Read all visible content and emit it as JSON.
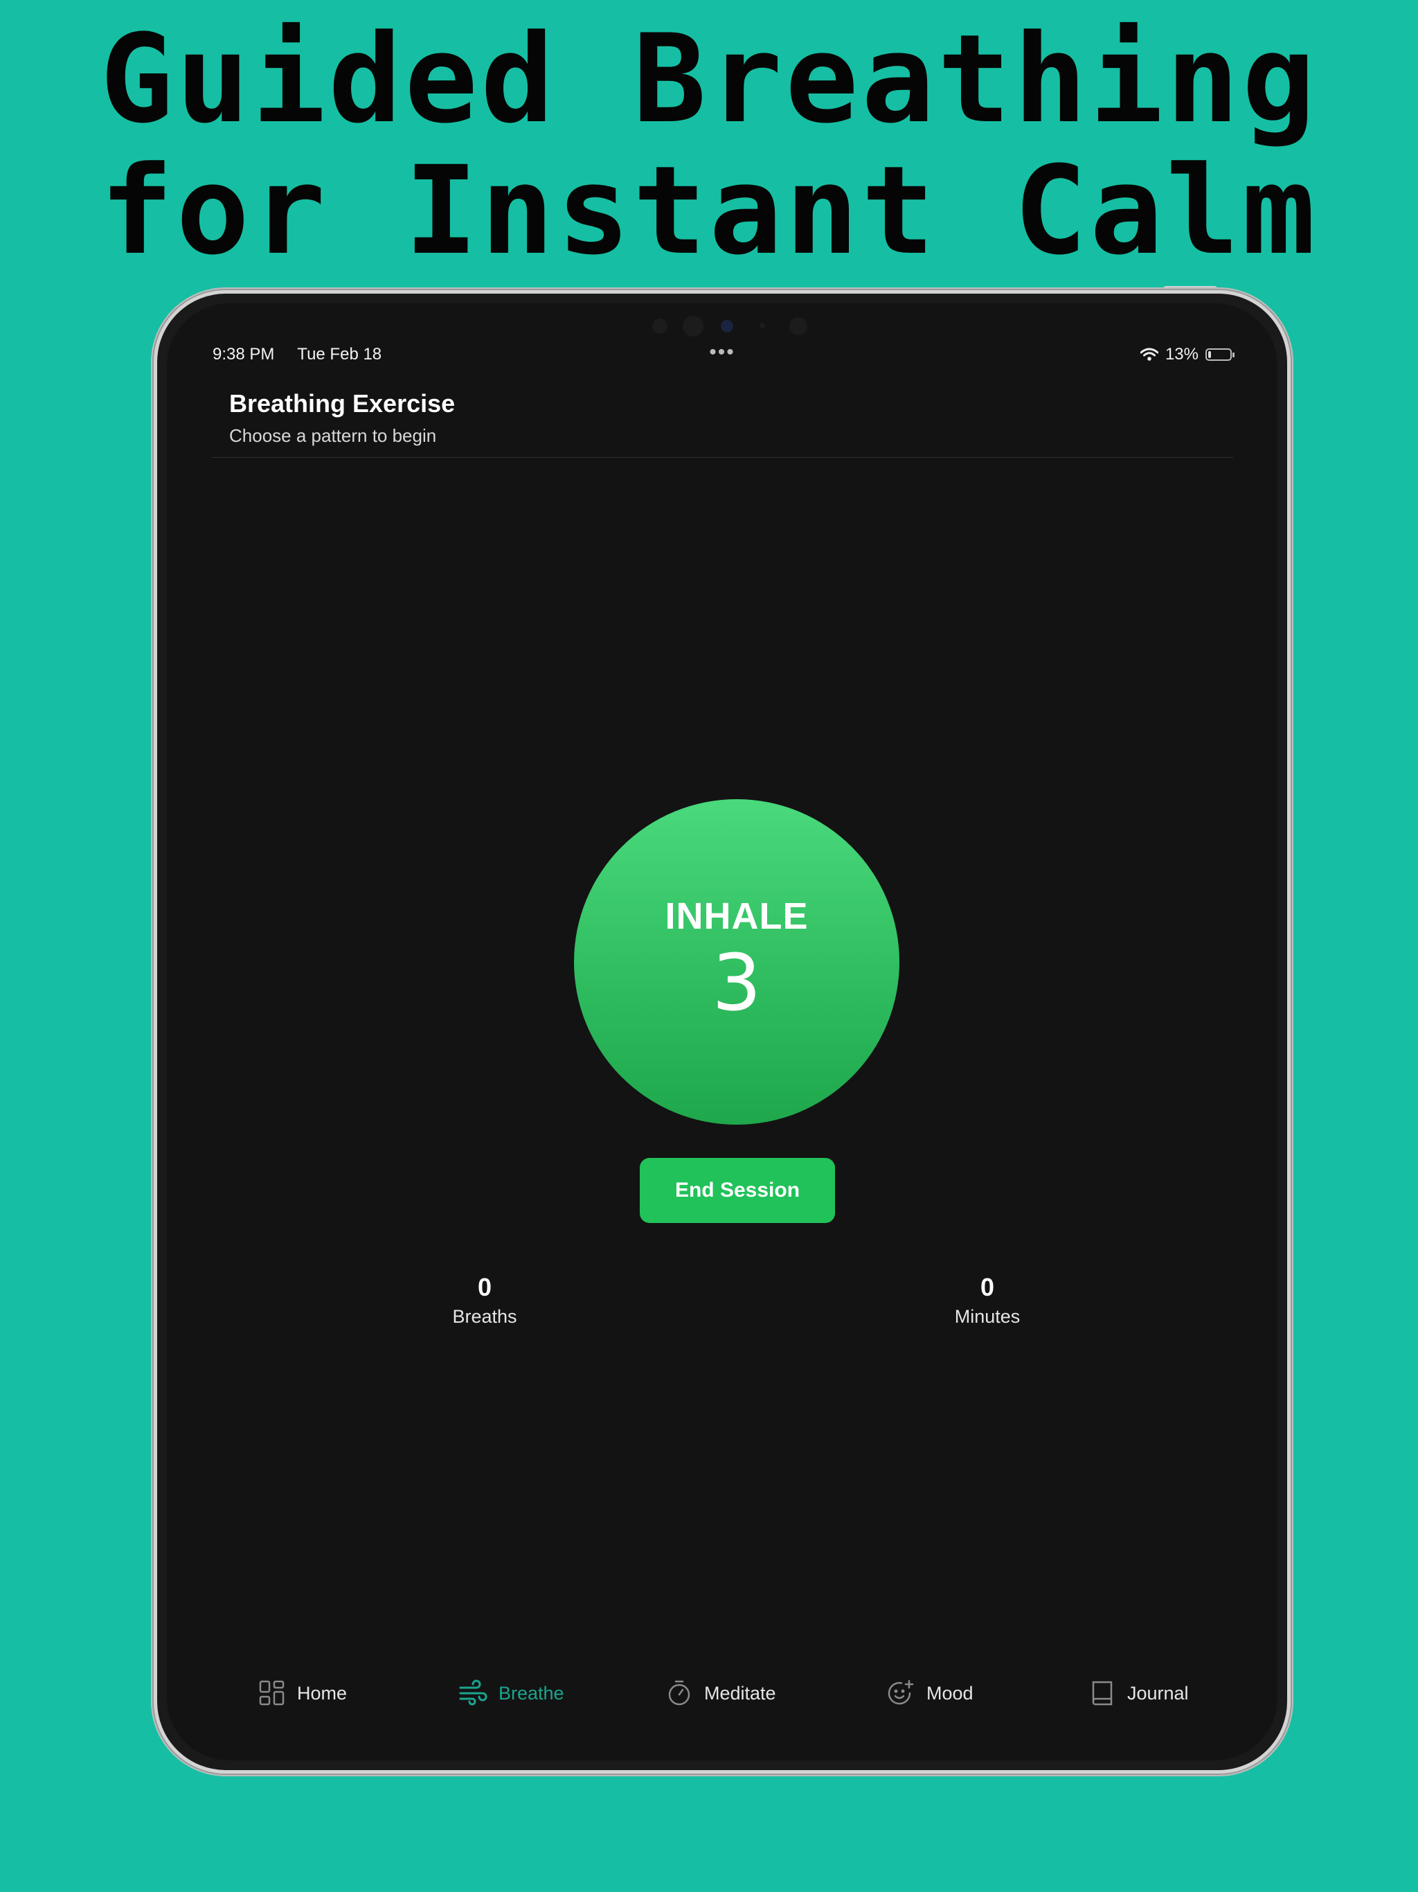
{
  "headline": {
    "line1": "Guided Breathing",
    "line2": "for Instant Calm"
  },
  "status_bar": {
    "time": "9:38 PM",
    "date": "Tue Feb 18",
    "dots": "•••",
    "battery_percent": "13%",
    "battery_level": 0.13
  },
  "header": {
    "title": "Breathing Exercise",
    "subtitle": "Choose a pattern to begin"
  },
  "session": {
    "phase": "INHALE",
    "count": "3",
    "end_button": "End Session"
  },
  "stats": [
    {
      "value": "0",
      "label": "Breaths"
    },
    {
      "value": "0",
      "label": "Minutes"
    }
  ],
  "tabs": [
    {
      "label": "Home",
      "icon": "grid-icon",
      "active": false
    },
    {
      "label": "Breathe",
      "icon": "wind-icon",
      "active": true
    },
    {
      "label": "Meditate",
      "icon": "timer-icon",
      "active": false
    },
    {
      "label": "Mood",
      "icon": "smile-plus-icon",
      "active": false
    },
    {
      "label": "Journal",
      "icon": "book-icon",
      "active": false
    }
  ],
  "colors": {
    "background": "#16BFA3",
    "accent": "#21C25A",
    "active_tab": "#1BA58E",
    "screen": "#131313"
  }
}
